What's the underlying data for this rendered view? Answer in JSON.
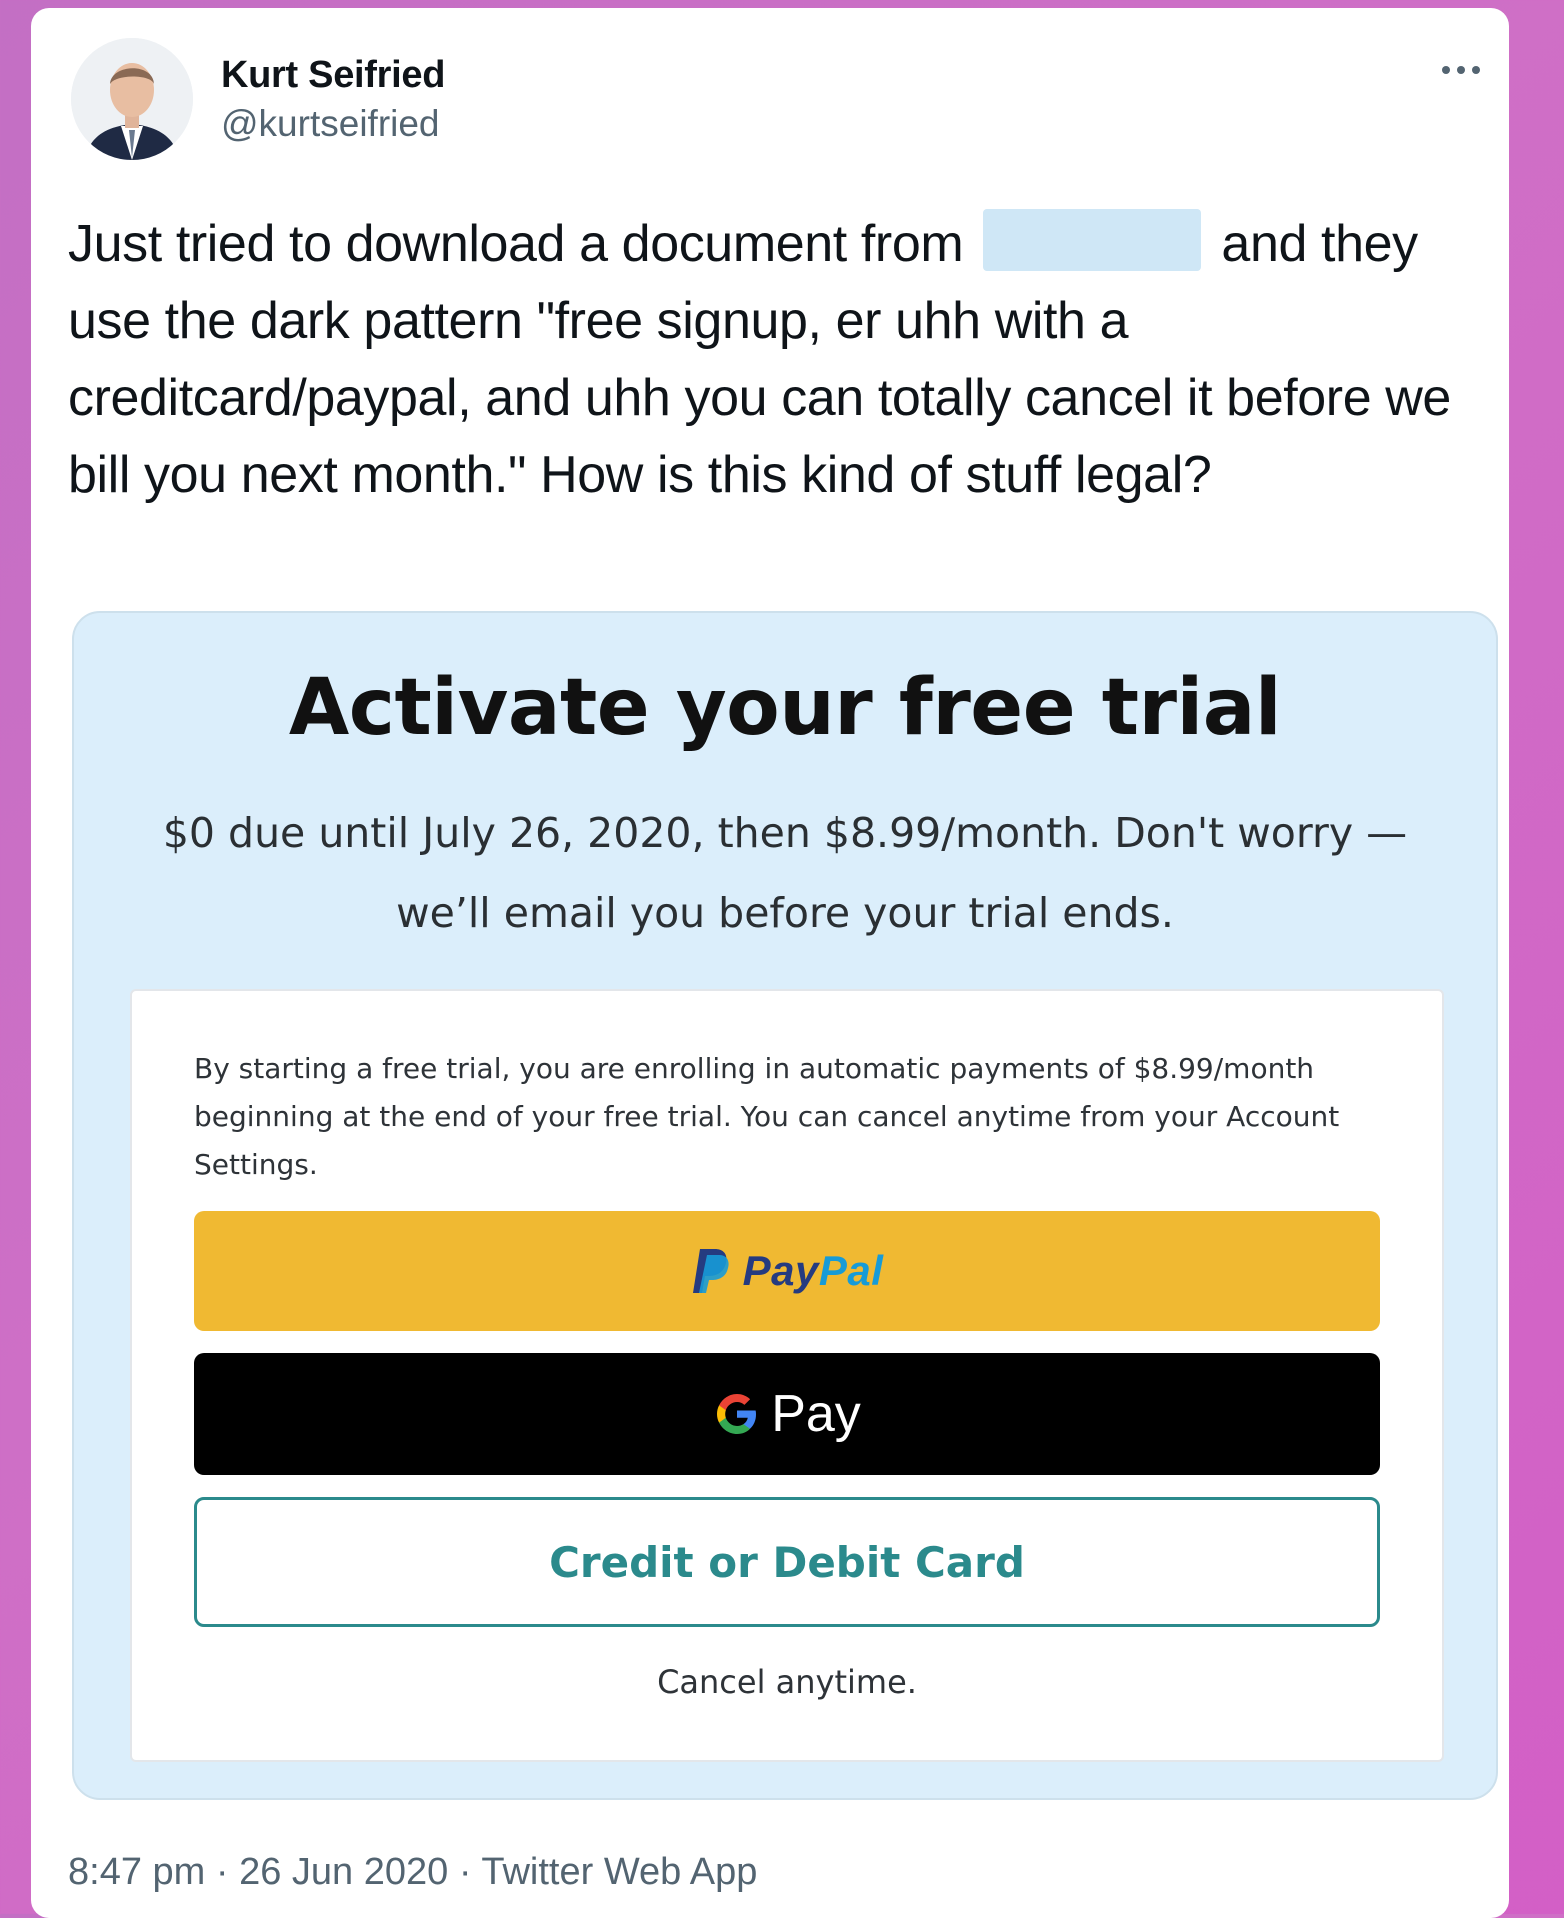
{
  "author": {
    "name": "Kurt Seifried",
    "handle": "@kurtseifried",
    "avatar_icon": "profile-photo"
  },
  "more_icon": "more-horizontal-icon",
  "tweet": {
    "text_before": "Just tried to download a document from",
    "text_after": "and they use the dark pattern \"free signup, er uhh with a creditcard/paypal, and uhh you can totally cancel it before we bill you next month.\" How is this kind of stuff legal?"
  },
  "screenshot": {
    "title": "Activate your free trial",
    "subtitle": "$0 due until July 26, 2020, then $8.99/month. Don't worry — we’ll email you before your trial ends.",
    "disclaimer": "By starting a free trial, you are enrolling in automatic payments of $8.99/month beginning at the end of your free trial. You can cancel anytime from your Account Settings.",
    "paypal_pay": "Pay",
    "paypal_pal": "Pal",
    "gpay_label": "Pay",
    "card_label": "Credit or Debit Card",
    "cancel_note": "Cancel anytime.",
    "colors": {
      "paypal_button": "#f0b932",
      "gpay_button": "#000000",
      "card_accent": "#2b8a8c",
      "panel_background": "#dbeefb"
    }
  },
  "footer": {
    "time": "8:47 pm",
    "separator": " · ",
    "date": "26 Jun 2020",
    "source": "Twitter Web App"
  }
}
